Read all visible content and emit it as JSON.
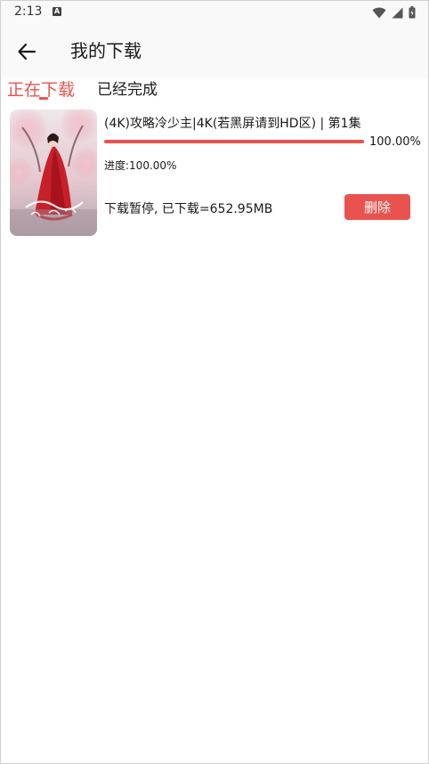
{
  "status_bar": {
    "time": "2:13",
    "notification_badge": "A"
  },
  "header": {
    "back_icon": "arrow-left-icon",
    "title": "我的下载"
  },
  "tabs": [
    {
      "label": "正在下载",
      "active": true
    },
    {
      "label": "已经完成",
      "active": false
    }
  ],
  "download_item": {
    "poster_icon": "movie-poster",
    "title": "(4K)攻略冷少主|4K(若黑屏请到HD区) | 第1集",
    "progress_percent": 100,
    "progress_text": "100.00%",
    "progress_label": "进度:100.00%",
    "status": "下载暂停, 已下载=652.95MB",
    "delete_label": "删除"
  },
  "colors": {
    "accent": "#e9534f",
    "text": "#1a1a1a",
    "header_bg": "#f9f9f9"
  }
}
